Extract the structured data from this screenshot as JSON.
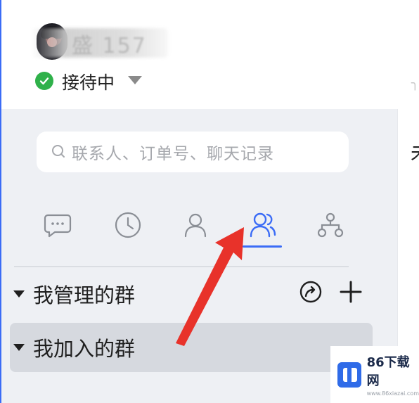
{
  "header": {
    "name_text": "盛 157",
    "status": {
      "label": "接待中",
      "color": "#2fb14a"
    }
  },
  "search": {
    "placeholder": "联系人、订单号、聊天记录"
  },
  "tabs": [
    {
      "icon": "chat-bubble-icon",
      "active": false
    },
    {
      "icon": "clock-icon",
      "active": false
    },
    {
      "icon": "person-icon",
      "active": false
    },
    {
      "icon": "group-icon",
      "active": true
    },
    {
      "icon": "org-chart-icon",
      "active": false
    }
  ],
  "groups": {
    "managed": {
      "label": "我管理的群"
    },
    "joined": {
      "label": "我加入的群"
    }
  },
  "right_panel": {
    "text": "未"
  },
  "watermark": {
    "title": "86下载网",
    "subtitle": "www.86xiazai.com"
  },
  "colors": {
    "accent": "#3b6cf6",
    "annotation_arrow": "#e8322a",
    "panel_bg": "#eef0f4"
  }
}
